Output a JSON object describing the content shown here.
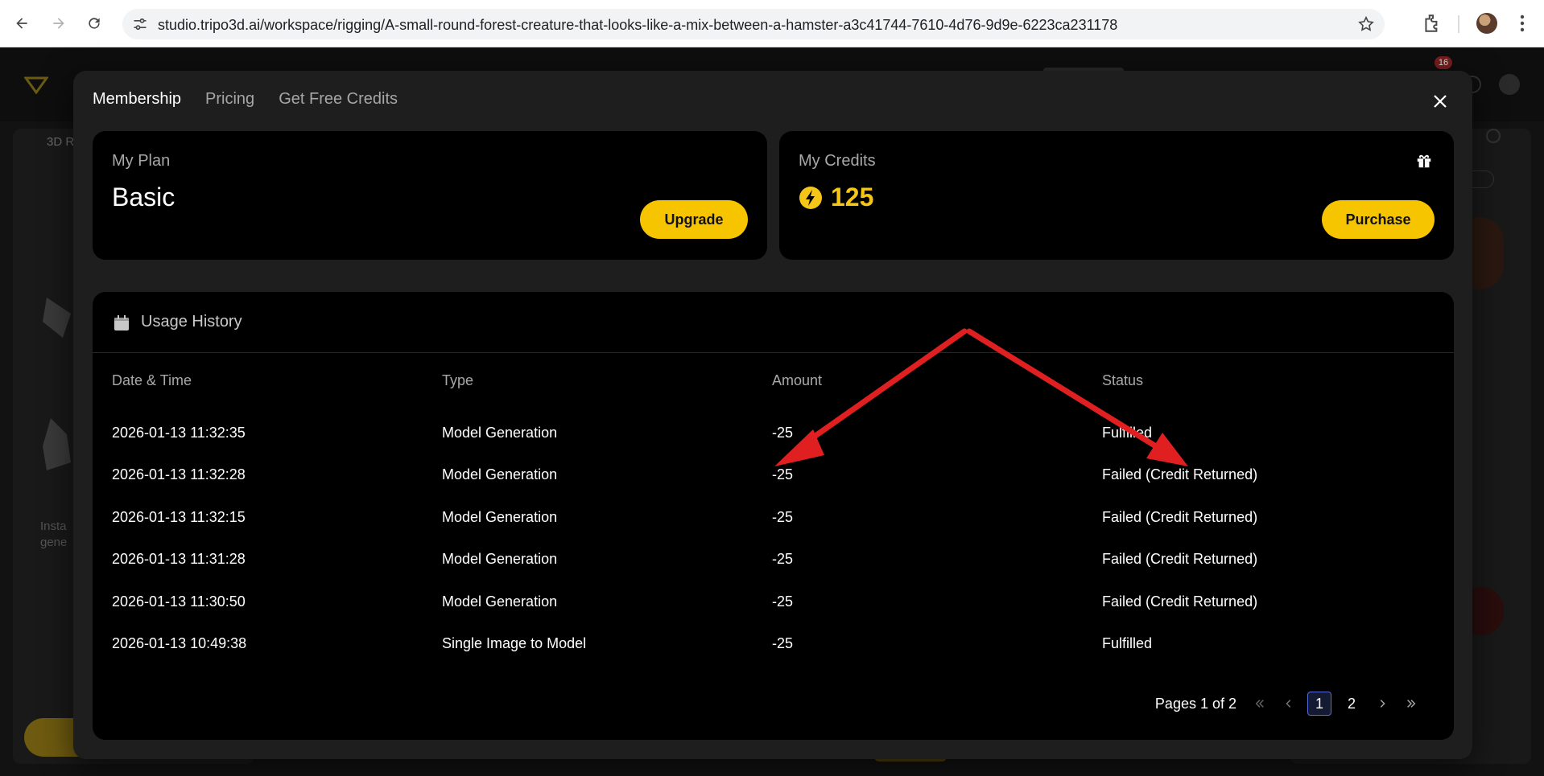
{
  "browser": {
    "url": "studio.tripo3d.ai/workspace/rigging/A-small-round-forest-creature-that-looks-like-a-mix-between-a-hamster-a3c41744-7610-4d76-9d9e-6223ca231178"
  },
  "background": {
    "panel_label": "3D R",
    "side_text_1": "Insta",
    "side_text_2": "gene",
    "badge": "16"
  },
  "modal": {
    "tabs": [
      {
        "label": "Membership",
        "active": true
      },
      {
        "label": "Pricing",
        "active": false
      },
      {
        "label": "Get Free Credits",
        "active": false
      }
    ],
    "plan": {
      "title": "My Plan",
      "name": "Basic",
      "button": "Upgrade"
    },
    "credits": {
      "title": "My Credits",
      "value": "125",
      "button": "Purchase"
    },
    "history": {
      "title": "Usage History",
      "columns": [
        "Date & Time",
        "Type",
        "Amount",
        "Status"
      ],
      "rows": [
        {
          "datetime": "2026-01-13 11:32:35",
          "type": "Model Generation",
          "amount": "-25",
          "status": "Fulfilled"
        },
        {
          "datetime": "2026-01-13 11:32:28",
          "type": "Model Generation",
          "amount": "-25",
          "status": "Failed (Credit Returned)"
        },
        {
          "datetime": "2026-01-13 11:32:15",
          "type": "Model Generation",
          "amount": "-25",
          "status": "Failed (Credit Returned)"
        },
        {
          "datetime": "2026-01-13 11:31:28",
          "type": "Model Generation",
          "amount": "-25",
          "status": "Failed (Credit Returned)"
        },
        {
          "datetime": "2026-01-13 11:30:50",
          "type": "Model Generation",
          "amount": "-25",
          "status": "Failed (Credit Returned)"
        },
        {
          "datetime": "2026-01-13 10:49:38",
          "type": "Single Image to Model",
          "amount": "-25",
          "status": "Fulfilled"
        }
      ],
      "pagination": {
        "label": "Pages 1 of 2",
        "pages": [
          "1",
          "2"
        ],
        "current": "1"
      }
    }
  },
  "colors": {
    "accent": "#f7c400",
    "annotation": "#e02020"
  }
}
